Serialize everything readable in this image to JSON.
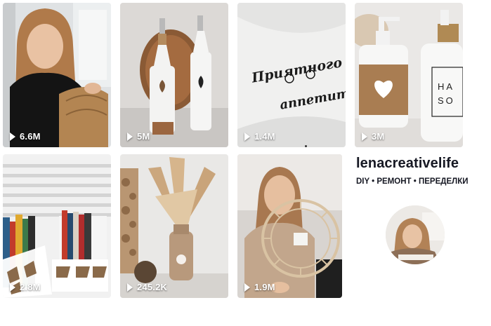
{
  "videos": [
    {
      "id": "1",
      "views": "6.6M",
      "icon": "play-icon"
    },
    {
      "id": "2",
      "views": "5M",
      "icon": "play-icon"
    },
    {
      "id": "3",
      "views": "1.4M",
      "icon": "play-icon"
    },
    {
      "id": "4",
      "views": "3M",
      "icon": "play-icon"
    },
    {
      "id": "5",
      "views": "2.8M",
      "icon": "play-icon"
    },
    {
      "id": "6",
      "views": "245.2K",
      "icon": "play-icon"
    },
    {
      "id": "7",
      "views": "1.9M",
      "icon": "play-icon"
    }
  ],
  "profile": {
    "username": "lenacreativelife",
    "bio": "DIY • РЕМОНТ • ПЕРЕДЕЛКИ"
  },
  "tile3_text": {
    "line1": "Приятного",
    "line2": "аппетита"
  },
  "tile4_label": {
    "line1": "HA",
    "line2": "SO"
  },
  "colors": {
    "text": "#161823",
    "views": "#ffffff",
    "background": "#ffffff"
  }
}
